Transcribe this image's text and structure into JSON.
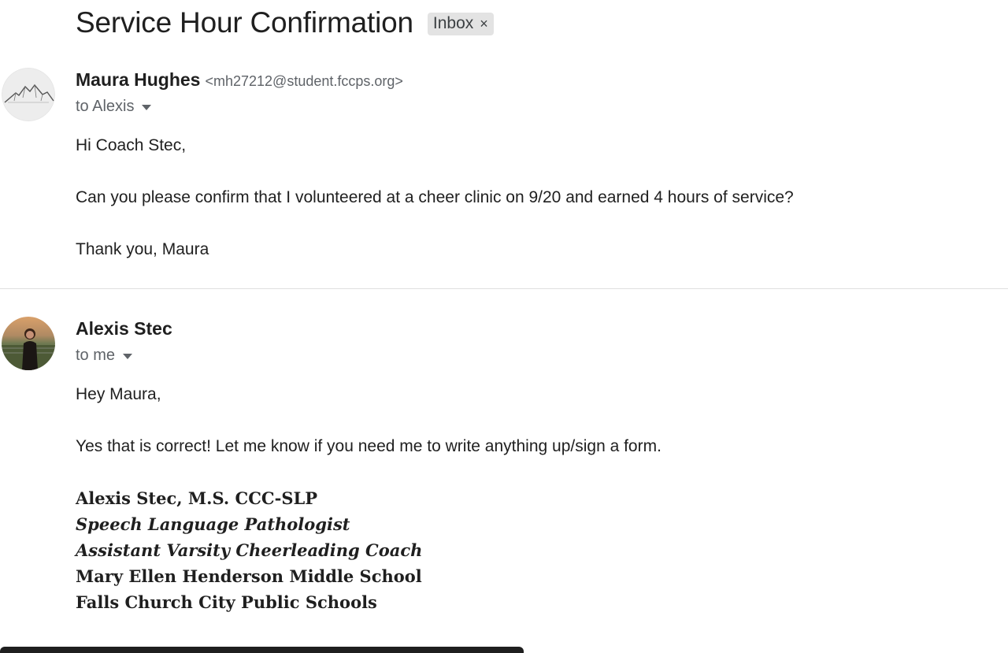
{
  "subject": "Service Hour Confirmation",
  "label_chip": {
    "text": "Inbox",
    "remove": "×"
  },
  "messages": [
    {
      "sender_name": "Maura Hughes",
      "sender_email": "<mh27212@student.fccps.org>",
      "to": "to Alexis",
      "body": [
        "Hi Coach Stec,",
        "Can you please confirm that I volunteered at a cheer clinic on 9/20 and earned 4 hours of service?",
        "Thank you, Maura"
      ]
    },
    {
      "sender_name": "Alexis Stec",
      "to": "to me",
      "body": [
        "Hey Maura,",
        "Yes that is correct! Let me know if you need me to write anything up/sign a form."
      ],
      "signature": [
        "Alexis Stec, M.S. CCC-SLP",
        "Speech Language Pathologist",
        "Assistant Varsity Cheerleading Coach",
        "Mary Ellen Henderson Middle School",
        "Falls Church City Public Schools"
      ]
    }
  ],
  "colors": {
    "chip_bg": "#e3e3e3",
    "secondary_text": "#5f6368",
    "divider": "#e0e0e0"
  }
}
